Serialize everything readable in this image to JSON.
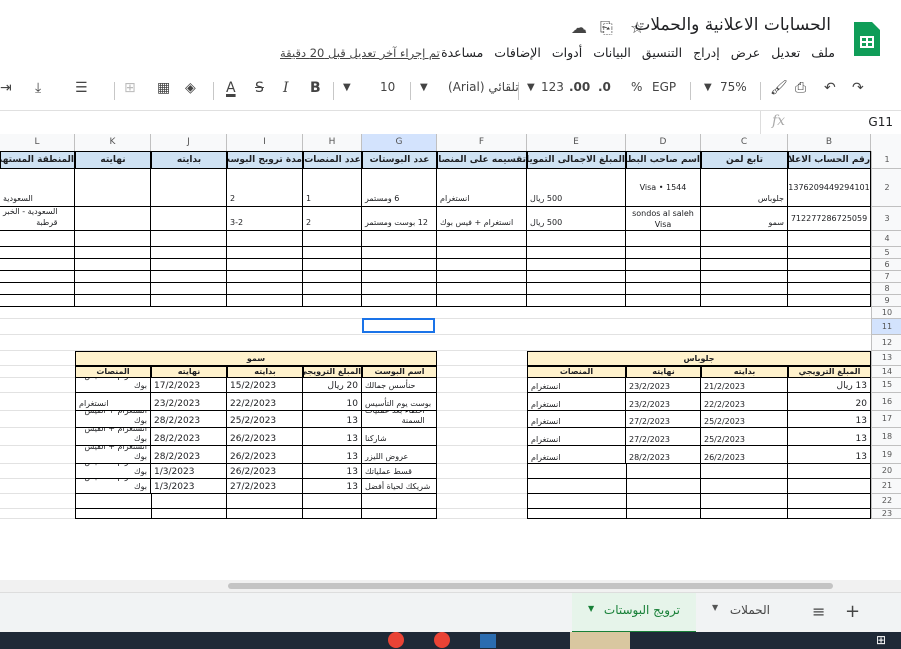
{
  "app": {
    "title": "الحسابات الاعلانية والحملات",
    "menu": [
      "ملف",
      "تعديل",
      "عرض",
      "إدراج",
      "التنسيق",
      "البيانات",
      "أدوات",
      "الإضافات",
      "مساعدة"
    ],
    "last_edit": "تم إجراء آخر تعديل قبل 20 دقيقة"
  },
  "toolbar": {
    "zoom": "75%",
    "currency": "EGP",
    "percent": "%",
    "dec_less": ".0",
    "dec_more": ".00",
    "number_format": "123",
    "font": "تلقائي (Arial)",
    "font_size": "10"
  },
  "formula": {
    "cell_ref": "G11",
    "fx": "fx"
  },
  "columns": [
    "B",
    "C",
    "D",
    "E",
    "F",
    "G",
    "H",
    "I",
    "J",
    "K",
    "L"
  ],
  "rows": [
    "1",
    "2",
    "3",
    "4",
    "5",
    "6",
    "7",
    "8",
    "9",
    "10",
    "11",
    "12",
    "13",
    "14",
    "15",
    "16",
    "17",
    "18",
    "19",
    "20",
    "21",
    "22",
    "23"
  ],
  "table_headers": [
    "رقم الحساب الاعلاني",
    "تابع لمن",
    "اسم صاحب البطاقة",
    "المبلغ الاجمالى التمويلى",
    "تقسيمه على المنصات",
    "عدد البوستات",
    "عدد المنصات",
    "مدة ترويج البوست",
    "بدايته",
    "نهايته",
    "المنطقة المستهدفة"
  ],
  "table_rows": [
    [
      "1376209449294101",
      "جلوباس",
      "Visa • 1544",
      "500 ريال",
      "انستغرام",
      "6 ومستمر",
      "1",
      "2",
      "",
      "",
      "السعودية"
    ],
    [
      "712277286725059",
      "سمو",
      "sondos al saleh\nVisa",
      "500 ريال",
      "انستغرام + فيس بوك",
      "12 بوست ومستمر",
      "2",
      "3-2",
      "",
      "",
      "السعودية - الخبر\nقرطبة"
    ]
  ],
  "glopas": {
    "title": "جلوباس",
    "headers": [
      "المبلغ الترويجي",
      "بدايته",
      "نهايته",
      "المنصات"
    ],
    "rows": [
      [
        "13 ريال",
        "21/2/2023",
        "23/2/2023",
        "انستغرام"
      ],
      [
        "20",
        "22/2/2023",
        "23/2/2023",
        "انستغرام"
      ],
      [
        "13",
        "25/2/2023",
        "27/2/2023",
        "انستغرام"
      ],
      [
        "13",
        "25/2/2023",
        "27/2/2023",
        "انستغرام"
      ],
      [
        "13",
        "26/2/2023",
        "28/2/2023",
        "انستغرام"
      ]
    ]
  },
  "somo": {
    "title": "سمو",
    "headers": [
      "اسم البوست",
      "المبلغ الترويجي",
      "بدايته",
      "نهايته",
      "المنصات"
    ],
    "rows": [
      [
        "حنأسس جمالك",
        "20 ريال",
        "15/2/2023",
        "17/2/2023",
        "انستغرام + الفيس بوك"
      ],
      [
        "بوست يوم التأسيس",
        "10",
        "22/2/2023",
        "23/2/2023",
        "انستغرام"
      ],
      [
        "أخطاء بعد عمليات\nالسمنة",
        "13",
        "25/2/2023",
        "28/2/2023",
        "انستغرام + الفيس بوك"
      ],
      [
        "شاركنا",
        "13",
        "26/2/2023",
        "28/2/2023",
        "انستغرام + الفيس بوك"
      ],
      [
        "عروض الليزر",
        "13",
        "26/2/2023",
        "28/2/2023",
        "انستغرام + الفيس بوك"
      ],
      [
        "قسط عملياتك",
        "13",
        "26/2/2023",
        "1/3/2023",
        "انستغرام + الفيس بوك"
      ],
      [
        "شريكك لحياة أفضل",
        "13",
        "27/2/2023",
        "1/3/2023",
        "انستغرام + الفيس بوك"
      ]
    ]
  },
  "sheets": [
    "ترويج البوستات",
    "الحملات"
  ],
  "colors": {
    "header_blue": "#cfe2f3",
    "header_yellow": "#fff2cc",
    "accent": "#188038"
  }
}
